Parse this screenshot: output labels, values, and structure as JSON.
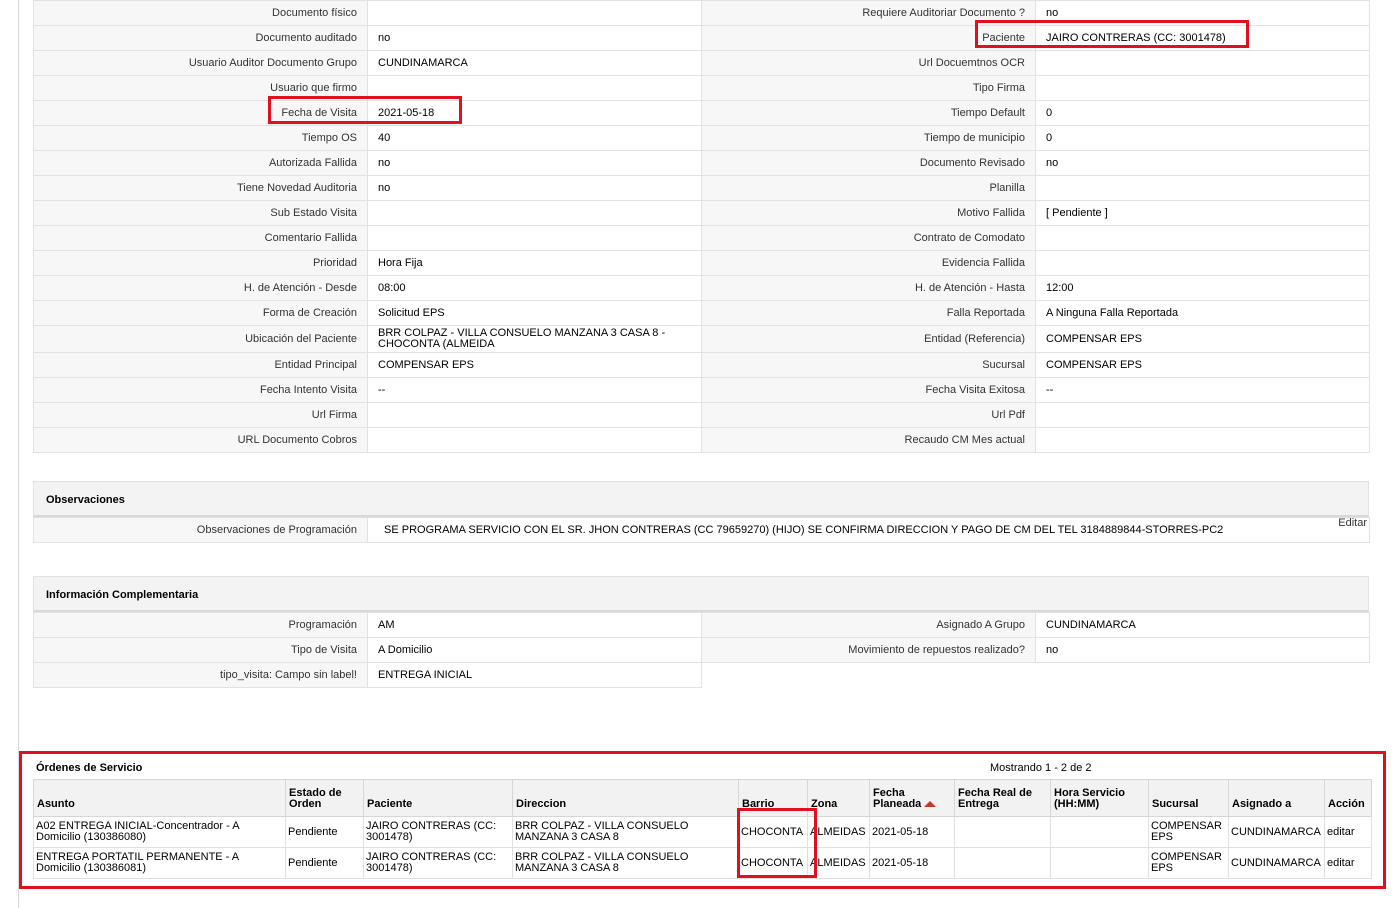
{
  "details": [
    {
      "l1": "Documento físico",
      "v1": "",
      "l2": "Requiere Auditoriar Documento ?",
      "v2": "no"
    },
    {
      "l1": "Documento auditado",
      "v1": "no",
      "l2": "Paciente",
      "v2": "JAIRO CONTRERAS (CC: 3001478)"
    },
    {
      "l1": "Usuario Auditor Documento Grupo",
      "v1": "CUNDINAMARCA",
      "l2": "Url Docuemtnos OCR",
      "v2": ""
    },
    {
      "l1": "Usuario que firmo",
      "v1": "",
      "l2": "Tipo Firma",
      "v2": ""
    },
    {
      "l1": "Fecha de Visita",
      "v1": "2021-05-18",
      "l2": "Tiempo Default",
      "v2": "0"
    },
    {
      "l1": "Tiempo OS",
      "v1": "40",
      "l2": "Tiempo de municipio",
      "v2": "0"
    },
    {
      "l1": "Autorizada Fallida",
      "v1": "no",
      "l2": "Documento Revisado",
      "v2": "no"
    },
    {
      "l1": "Tiene Novedad Auditoria",
      "v1": "no",
      "l2": "Planilla",
      "v2": ""
    },
    {
      "l1": "Sub Estado Visita",
      "v1": "",
      "l2": "Motivo Fallida",
      "v2": "[ Pendiente ]"
    },
    {
      "l1": "Comentario Fallida",
      "v1": "",
      "l2": "Contrato de Comodato",
      "v2": ""
    },
    {
      "l1": "Prioridad",
      "v1": "Hora Fija",
      "l2": "Evidencia Fallida",
      "v2": ""
    },
    {
      "l1": "H. de Atención - Desde",
      "v1": "08:00",
      "l2": "H. de Atención - Hasta",
      "v2": "12:00"
    },
    {
      "l1": "Forma de Creación",
      "v1": "Solicitud EPS",
      "l2": "Falla Reportada",
      "v2": "A Ninguna Falla Reportada"
    },
    {
      "l1": "Ubicación del Paciente",
      "v1": "BRR COLPAZ - VILLA CONSUELO MANZANA 3 CASA 8 - CHOCONTA (ALMEIDA",
      "l2": "Entidad (Referencia)",
      "v2": "COMPENSAR EPS"
    },
    {
      "l1": "Entidad Principal",
      "v1": "COMPENSAR EPS",
      "l2": "Sucursal",
      "v2": "COMPENSAR EPS"
    },
    {
      "l1": "Fecha Intento Visita",
      "v1": "--",
      "l2": "Fecha Visita Exitosa",
      "v2": "--"
    },
    {
      "l1": "Url Firma",
      "v1": "",
      "l2": "Url Pdf",
      "v2": ""
    },
    {
      "l1": "URL Documento Cobros",
      "v1": "",
      "l2": "Recaudo CM Mes actual",
      "v2": ""
    }
  ],
  "observaciones": {
    "title": "Observaciones",
    "label": "Observaciones de Programación",
    "value": "SE PROGRAMA SERVICIO CON EL SR. JHON CONTRERAS (CC 79659270) (HIJO) SE CONFIRMA DIRECCION Y PAGO DE CM DEL TEL 3184889844-STORRES-PC2",
    "edit": "Editar"
  },
  "info": {
    "title": "Información Complementaria",
    "rows": [
      {
        "l1": "Programación",
        "v1": "AM",
        "l2": "Asignado A Grupo",
        "v2": "CUNDINAMARCA"
      },
      {
        "l1": "Tipo de Visita",
        "v1": "A Domicilio",
        "l2": "Movimiento de repuestos realizado?",
        "v2": "no"
      },
      {
        "l1": "tipo_visita: Campo sin label!",
        "v1": "ENTREGA INICIAL"
      }
    ]
  },
  "orders": {
    "title": "Órdenes de Servicio",
    "count": "Mostrando 1 - 2 de 2",
    "columns": [
      "Asunto",
      "Estado de Orden",
      "Paciente",
      "Direccion",
      "Barrio",
      "Zona",
      "Fecha Planeada",
      "Fecha Real de Entrega",
      "Hora Servicio (HH:MM)",
      "Sucursal",
      "Asignado a",
      "Acción"
    ],
    "rows": [
      {
        "asunto": "A02 ENTREGA INICIAL-Concentrador - A Domicilio (130386080)",
        "estado": "Pendiente",
        "paciente": "JAIRO CONTRERAS (CC: 3001478)",
        "direccion": "BRR COLPAZ - VILLA CONSUELO MANZANA 3 CASA 8",
        "barrio": "CHOCONTA",
        "zona": "ALMEIDAS",
        "fecha": "2021-05-18",
        "fecha_real": "",
        "hora": "",
        "sucursal": "COMPENSAR EPS",
        "asignado": "CUNDINAMARCA",
        "accion": "editar"
      },
      {
        "asunto": "ENTREGA PORTATIL PERMANENTE - A Domicilio (130386081)",
        "estado": "Pendiente",
        "paciente": "JAIRO CONTRERAS (CC: 3001478)",
        "direccion": "BRR COLPAZ - VILLA CONSUELO MANZANA 3 CASA 8",
        "barrio": "CHOCONTA",
        "zona": "ALMEIDAS",
        "fecha": "2021-05-18",
        "fecha_real": "",
        "hora": "",
        "sucursal": "COMPENSAR EPS",
        "asignado": "CUNDINAMARCA",
        "accion": "editar"
      }
    ]
  },
  "colors": {
    "highlight": "#e0101e",
    "sort_arrow": "#c0392b"
  },
  "icons": {
    "sort": "sort-up-icon"
  }
}
